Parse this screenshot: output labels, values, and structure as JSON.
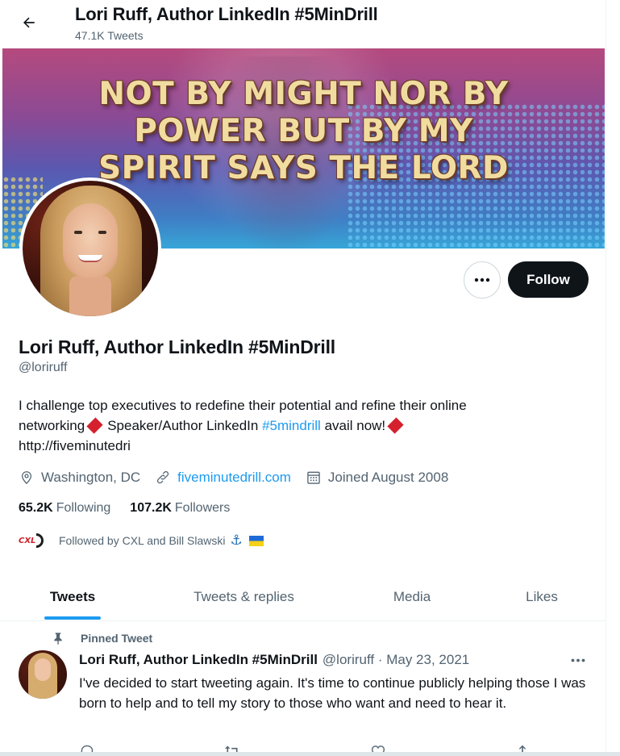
{
  "header": {
    "title": "Lori Ruff, Author LinkedIn #5MinDrill",
    "subtitle": "47.1K Tweets"
  },
  "banner": {
    "lines": [
      "NOT BY MIGHT NOR BY",
      "POWER BUT BY MY",
      "SPIRIT SAYS THE LORD"
    ]
  },
  "actions": {
    "follow_label": "Follow"
  },
  "profile": {
    "name": "Lori Ruff, Author LinkedIn #5MinDrill",
    "handle": "@loriruff",
    "bio_part1": "I challenge top executives to redefine their potential and refine their online networking",
    "bio_part2": "Speaker/Author LinkedIn",
    "bio_hashtag": "#5mindrill",
    "bio_part3": "avail now!",
    "bio_part4": "http://fiveminutedri",
    "location": "Washington, DC",
    "website": "fiveminutedrill.com",
    "joined": "Joined August 2008",
    "following_count": "65.2K",
    "following_label": "Following",
    "followers_count": "107.2K",
    "followers_label": "Followers",
    "followed_by": "Followed by CXL and Bill Slawski",
    "followed_by_logo_text": "CXL"
  },
  "tabs": [
    {
      "label": "Tweets"
    },
    {
      "label": "Tweets & replies"
    },
    {
      "label": "Media"
    },
    {
      "label": "Likes"
    }
  ],
  "pinned_tweet": {
    "pinned_label": "Pinned Tweet",
    "author": "Lori Ruff, Author LinkedIn #5MinDrill",
    "meta": "@loriruff · May 23, 2021",
    "text": "I've decided to start tweeting again. It's time to continue publicly helping those I was born to help and to tell my story to those who want and need to hear it."
  },
  "colors": {
    "accent": "#1d9bf0",
    "follow_button": "#0f1419",
    "diamond": "#d4212d"
  },
  "icons": [
    "back-arrow-icon",
    "more-icon",
    "location-icon",
    "link-icon",
    "calendar-icon",
    "pin-icon",
    "reply-icon",
    "retweet-icon",
    "like-icon",
    "share-icon"
  ]
}
